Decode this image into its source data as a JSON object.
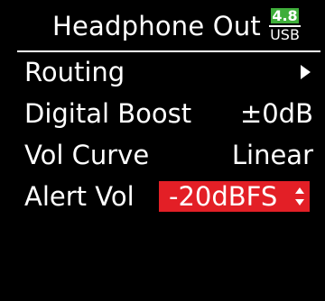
{
  "header": {
    "title": "Headphone Out",
    "battery": {
      "level": "4.8",
      "source": "USB"
    }
  },
  "menu": {
    "items": [
      {
        "label": "Routing",
        "value": "",
        "has_submenu": true
      },
      {
        "label": "Digital Boost",
        "value": "±0dB"
      },
      {
        "label": "Vol Curve",
        "value": "Linear"
      },
      {
        "label": "Alert Vol",
        "value": "-20dBFS",
        "selected": true
      }
    ]
  },
  "colors": {
    "background": "#000000",
    "text": "#ffffff",
    "selection": "#e31f26",
    "battery": "#3fae3a"
  }
}
